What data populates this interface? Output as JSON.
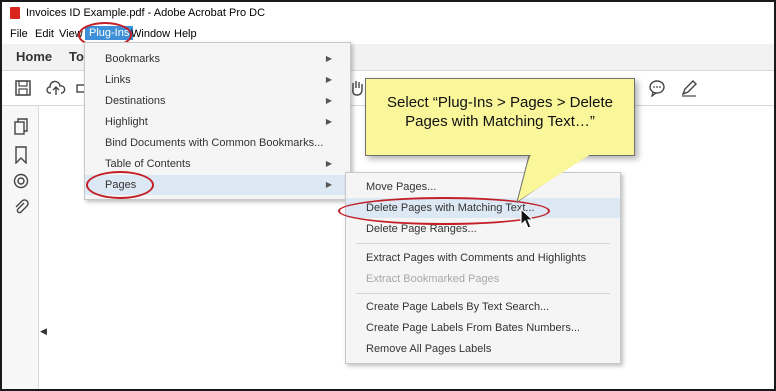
{
  "window": {
    "title": "Invoices ID Example.pdf - Adobe Acrobat Pro DC"
  },
  "menubar": {
    "items": [
      "File",
      "Edit",
      "View",
      "Plug-Ins",
      "Window",
      "Help"
    ]
  },
  "tabs": {
    "home": "Home",
    "tools": "To"
  },
  "plugins_menu": {
    "items": [
      {
        "label": "Bookmarks",
        "submenu": true
      },
      {
        "label": "Links",
        "submenu": true
      },
      {
        "label": "Destinations",
        "submenu": true
      },
      {
        "label": "Highlight",
        "submenu": true
      },
      {
        "label": "Bind Documents with Common Bookmarks...",
        "submenu": false
      },
      {
        "label": "Table of Contents",
        "submenu": true
      },
      {
        "label": "Pages",
        "submenu": true
      }
    ]
  },
  "pages_submenu": {
    "items": [
      {
        "label": "Move Pages..."
      },
      {
        "label": "Delete Pages with Matching Text..."
      },
      {
        "label": "Delete Page Ranges..."
      },
      {
        "label": "Extract Pages with Comments and Highlights"
      },
      {
        "label": "Extract Bookmarked Pages",
        "disabled": true
      },
      {
        "label": "Create Page Labels By Text Search..."
      },
      {
        "label": "Create Page Labels From Bates Numbers..."
      },
      {
        "label": "Remove All Pages Labels"
      }
    ]
  },
  "callout": {
    "text": "Select “Plug-Ins > Pages > Delete Pages with Matching Text…”"
  },
  "icons": [
    "pdf-file-icon",
    "save-icon",
    "upload-icon",
    "hand-icon",
    "comment-icon",
    "pen-icon",
    "pages-icon",
    "bookmark-icon",
    "target-icon",
    "attachment-icon",
    "cursor-icon"
  ],
  "colors": {
    "menu_active": "#3d8fd8",
    "highlight_oval": "#c22026",
    "callout_bg": "#f9f79a",
    "hover_item": "#dde8f5"
  }
}
